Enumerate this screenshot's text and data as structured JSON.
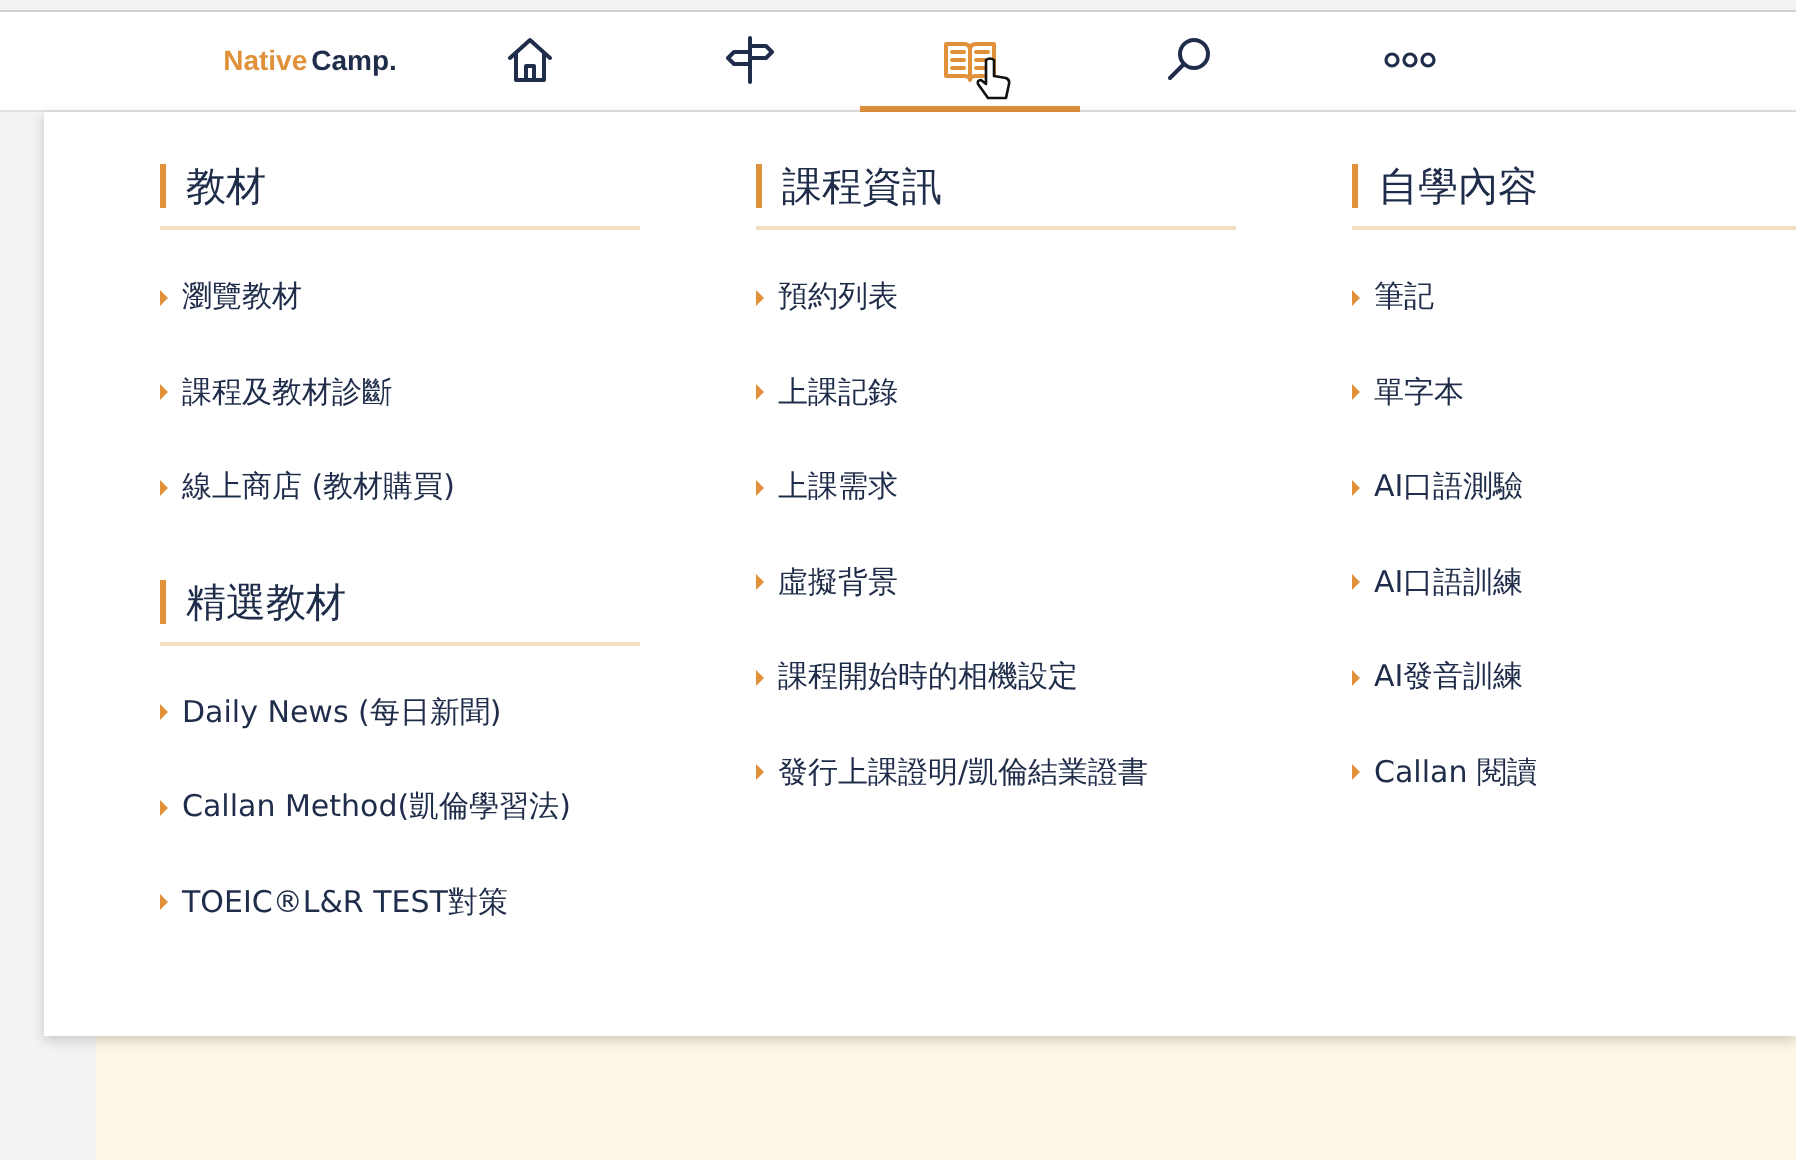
{
  "logo": {
    "parts": [
      "Native",
      "Camp."
    ]
  },
  "nav": [
    {
      "selected": false
    },
    {
      "selected": false
    },
    {
      "selected": true
    },
    {
      "selected": false
    },
    {
      "selected": false
    }
  ],
  "menu_columns": [
    {
      "sections": [
        {
          "title": "教材",
          "items": [
            "瀏覽教材",
            "課程及教材診斷",
            "線上商店 (教材購買)"
          ]
        },
        {
          "title": "精選教材",
          "items": [
            "Daily News (每日新聞)",
            "Callan Method(凱倫學習法)",
            "TOEIC®L&R TEST對策"
          ]
        }
      ]
    },
    {
      "sections": [
        {
          "title": "課程資訊",
          "items": [
            "預約列表",
            "上課記錄",
            "上課需求",
            "虛擬背景",
            "課程開始時的相機設定",
            "發行上課證明/凱倫結業證書"
          ]
        }
      ]
    },
    {
      "sections": [
        {
          "title": "自學內容",
          "items": [
            "筆記",
            "單字本",
            "AI口語測驗",
            "AI口語訓練",
            "AI發音訓練",
            "Callan 閱讀"
          ]
        }
      ]
    }
  ]
}
